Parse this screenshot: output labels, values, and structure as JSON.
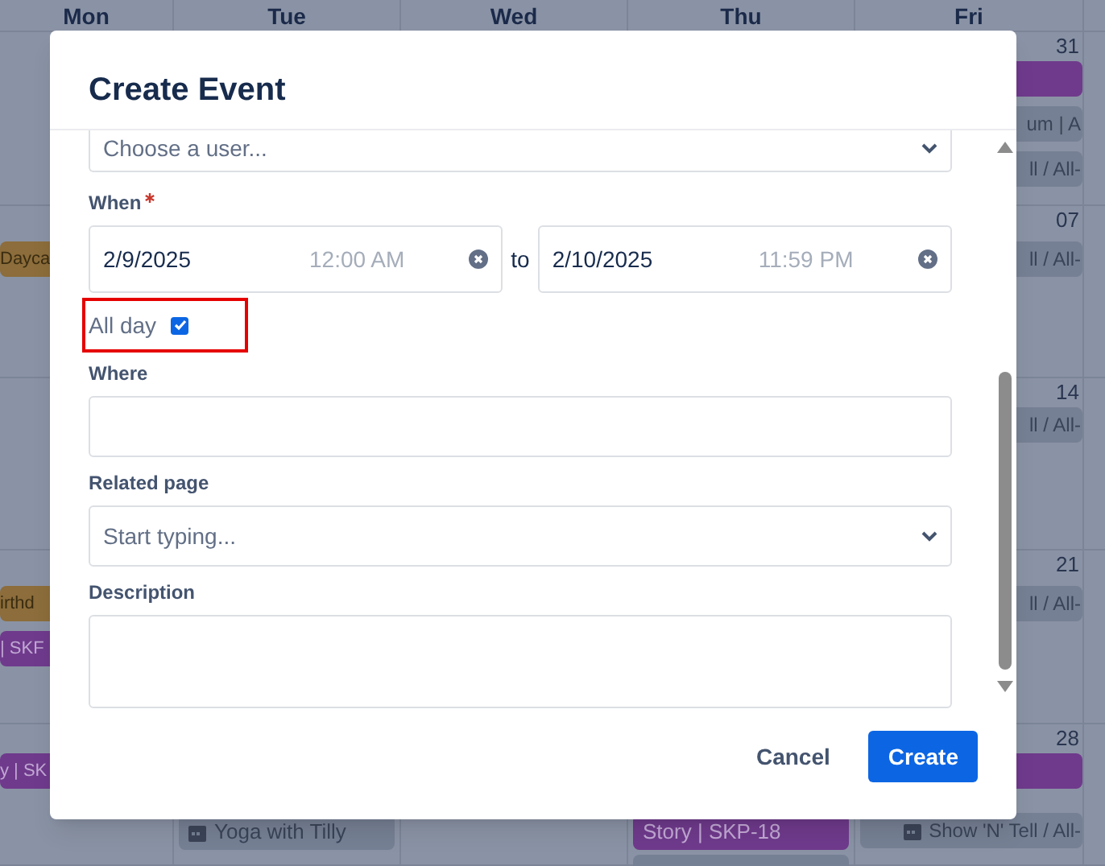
{
  "calendar": {
    "weekdays": [
      "Mon",
      "Tue",
      "Wed",
      "Thu",
      "Fri"
    ],
    "weeks": [
      {
        "fri": {
          "number": "31",
          "events": [
            {
              "color": "#6f3a8c"
            },
            {
              "color": "#768094",
              "text": "um | A"
            },
            {
              "color": "#768094",
              "text": "ll / All-"
            }
          ]
        }
      },
      {
        "mon": {
          "events": [
            {
              "color": "#8c6d3b",
              "text": "Dayca"
            }
          ]
        },
        "fri": {
          "number": "07",
          "events": [
            {
              "color": "#768094",
              "text": "ll / All-"
            }
          ]
        }
      },
      {
        "fri": {
          "number": "14",
          "events": [
            {
              "color": "#768094",
              "text": "ll / All-"
            }
          ]
        }
      },
      {
        "mon": {
          "events": [
            {
              "color": "#8c6d3b",
              "text": "irthd"
            },
            {
              "color": "#6f3a8c",
              "text": "| SKF"
            }
          ]
        },
        "fri": {
          "number": "21",
          "events": [
            {
              "color": "#768094",
              "text": "ll / All-"
            }
          ]
        }
      },
      {
        "mon": {
          "events": [
            {
              "color": "#6f3a8c",
              "text": "y | SK"
            }
          ]
        },
        "tue": {
          "events": [
            {
              "color": "#768094",
              "text": "Yoga with Tilly",
              "icon": true
            }
          ]
        },
        "thu": {
          "events": [
            {
              "color": "#6f3a8c",
              "text": "Story | SKP-18"
            },
            {
              "color": "#768094"
            }
          ]
        },
        "fri": {
          "number": "28",
          "events": [
            {
              "color": "#6f3a8c"
            },
            {
              "color": "#768094",
              "text": "Show 'N' Tell / All-",
              "icon": true
            }
          ]
        }
      }
    ]
  },
  "dialog": {
    "title": "Create Event",
    "fields": [
      {
        "kind": "select",
        "placeholder": "Choose a user..."
      },
      {
        "kind": "daterange",
        "label": "When",
        "required": true,
        "start": {
          "date": "2/9/2025",
          "time": "12:00 AM"
        },
        "separator": "to",
        "end": {
          "date": "2/10/2025",
          "time": "11:59 PM"
        }
      },
      {
        "kind": "checkbox",
        "label": "All day",
        "checked": true,
        "highlighted": true
      },
      {
        "kind": "text",
        "label": "Where"
      },
      {
        "kind": "select",
        "label": "Related page",
        "placeholder": "Start typing..."
      },
      {
        "kind": "textarea",
        "label": "Description"
      }
    ],
    "buttons": [
      {
        "label": "Cancel",
        "kind": "subtle"
      },
      {
        "label": "Create",
        "kind": "primary"
      }
    ]
  }
}
